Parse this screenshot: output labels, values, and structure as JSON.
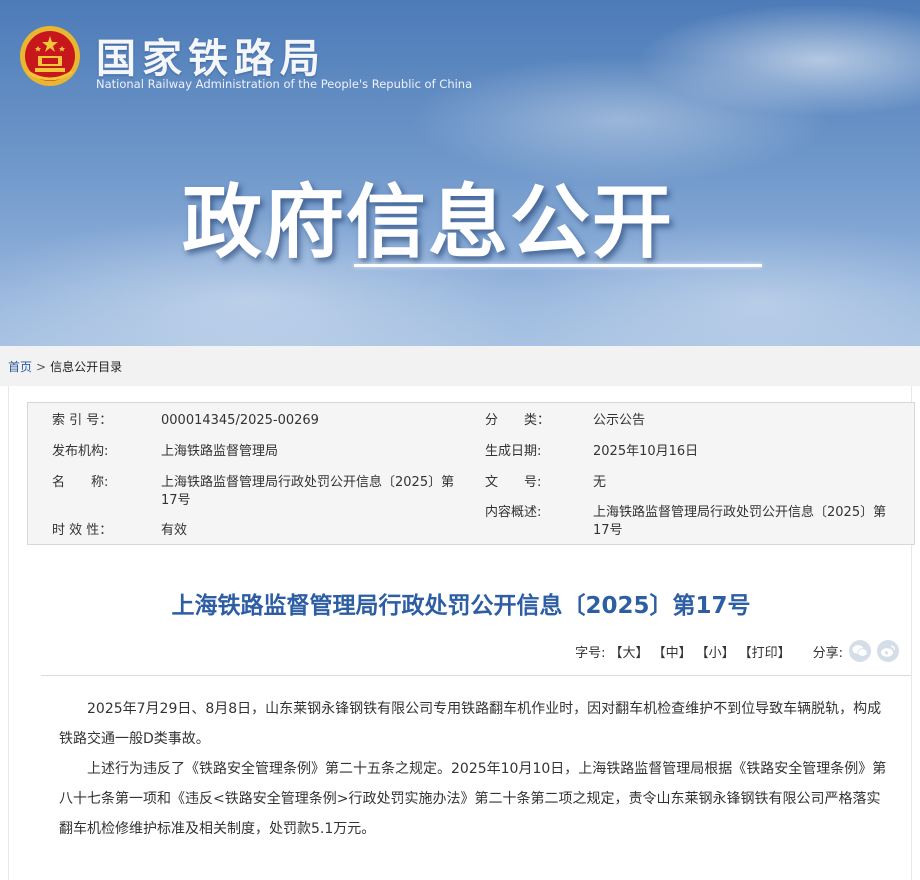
{
  "header": {
    "site_name": "国家铁路局",
    "site_name_en": "National Railway Administration of the People's Republic of China",
    "banner_title": "政府信息公开"
  },
  "breadcrumb": {
    "home": "首页",
    "separator": ">",
    "current": "信息公开目录"
  },
  "meta": {
    "index_no_label": "索 引 号：",
    "index_no": "000014345/2025-00269",
    "category_label": "分　　类：",
    "category": "公示公告",
    "publisher_label": "发布机构:",
    "publisher": "上海铁路监督管理局",
    "date_label": "生成日期:",
    "date": "2025年10月16日",
    "name_label": "名　　称:",
    "name_line1": "上海铁路监督管理局行政处罚公开信息〔2025〕第",
    "name_line2": "17号",
    "doc_no_label": "文　　号:",
    "doc_no": "无",
    "summary_label": "内容概述:",
    "summary_line1": "上海铁路监督管理局行政处罚公开信息〔2025〕第",
    "summary_line2": "17号",
    "validity_label": "时 效 性：",
    "validity": "有效"
  },
  "article": {
    "title": "上海铁路监督管理局行政处罚公开信息〔2025〕第17号",
    "font_size_label": "字号:",
    "size_large": "【大】",
    "size_medium": "【中】",
    "size_small": "【小】",
    "print": "【打印】",
    "share_label": "分享:",
    "share_icons": [
      "wechat-icon",
      "weibo-icon"
    ],
    "paragraphs": [
      "2025年7月29日、8月8日，山东莱钢永锋钢铁有限公司专用铁路翻车机作业时，因对翻车机检查维护不到位导致车辆脱轨，构成铁路交通一般D类事故。",
      "上述行为违反了《铁路安全管理条例》第二十五条之规定。2025年10月10日，上海铁路监督管理局根据《铁路安全管理条例》第八十七条第一项和《违反<铁路安全管理条例>行政处罚实施办法》第二十条第二项之规定，责令山东莱钢永锋钢铁有限公司严格落实翻车机检修维护标准及相关制度，处罚款5.1万元。"
    ]
  },
  "colors": {
    "title_blue": "#2d5ea3",
    "link_blue": "#2a5a9e",
    "emblem_red": "#c8161d",
    "emblem_gold": "#e8b630"
  }
}
